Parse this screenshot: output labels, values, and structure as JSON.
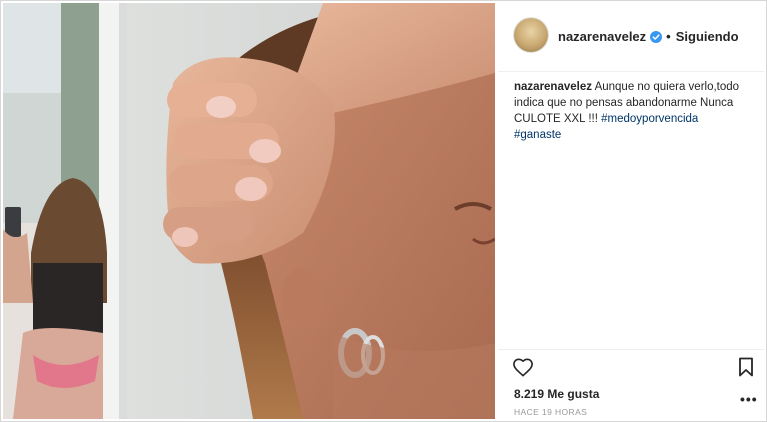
{
  "post": {
    "username": "nazarenavelez",
    "follow_status": "Siguiendo",
    "separator": "•",
    "caption_text": "Aunque no quiera verlo,todo indica que no pensas abandonarme Nunca CULOTE XXL !!!",
    "hashtags": [
      "#medoyporvencida",
      "#ganaste"
    ],
    "likes_text": "8.219 Me gusta",
    "timestamp": "HACE 19 HORAS",
    "more_options": "•••"
  },
  "icons": {
    "verified": "verified-badge-icon",
    "like": "heart-icon",
    "save": "bookmark-icon",
    "more": "more-options-icon"
  },
  "colors": {
    "verified": "#3897f0",
    "hashtag": "#003569",
    "text": "#262626",
    "muted": "#999999"
  }
}
